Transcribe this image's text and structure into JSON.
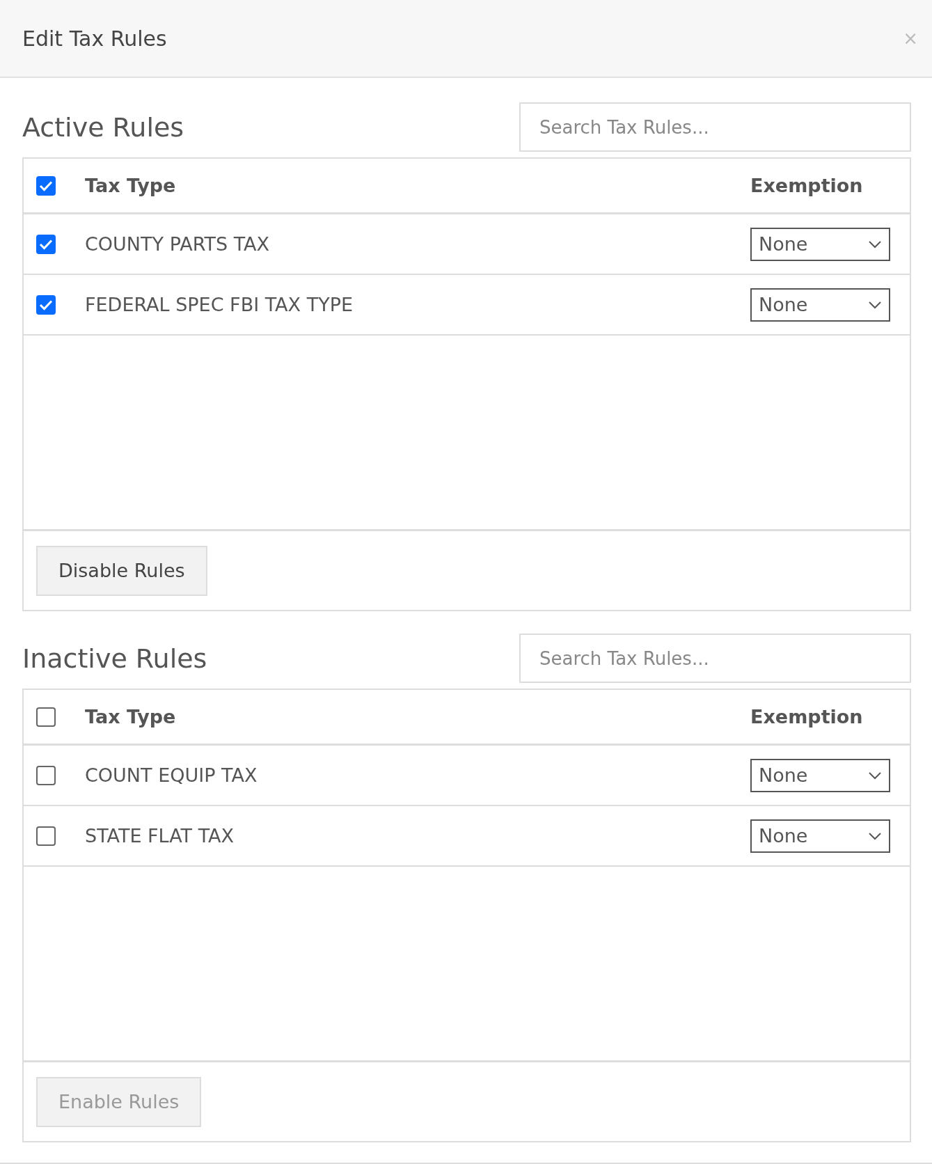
{
  "dialog": {
    "title": "Edit Tax Rules",
    "close": "×"
  },
  "sections": [
    {
      "title": "Active Rules",
      "search": {
        "placeholder": "Search Tax Rules..."
      },
      "select_all": {
        "checked": true
      },
      "columns": [
        "Tax Type",
        "Exemption"
      ],
      "rows": [
        {
          "tax_type": "COUNTY PARTS TAX",
          "checked": true,
          "exemption": "None"
        },
        {
          "tax_type": "FEDERAL SPEC FBI TAX TYPE",
          "checked": true,
          "exemption": "None"
        }
      ],
      "button": {
        "label": "Disable Rules",
        "disabled": false
      }
    },
    {
      "title": "Inactive Rules",
      "search": {
        "placeholder": "Search Tax Rules..."
      },
      "select_all": {
        "checked": false
      },
      "columns": [
        "Tax Type",
        "Exemption"
      ],
      "rows": [
        {
          "tax_type": "COUNT EQUIP TAX",
          "checked": false,
          "exemption": "None"
        },
        {
          "tax_type": "STATE FLAT TAX",
          "checked": false,
          "exemption": "None"
        }
      ],
      "button": {
        "label": "Enable Rules",
        "disabled": true
      }
    }
  ]
}
